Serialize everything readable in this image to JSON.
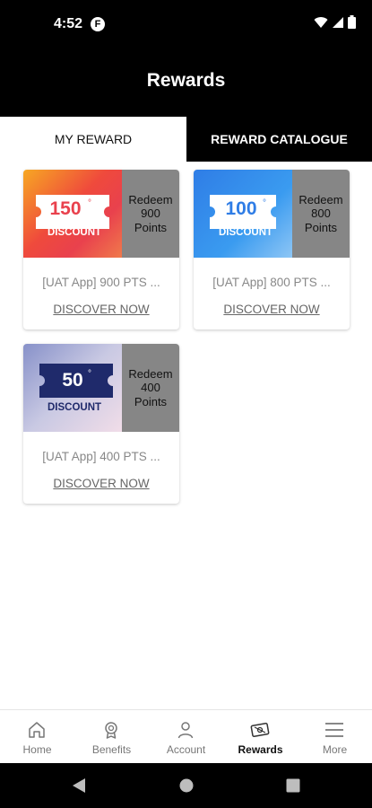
{
  "status_bar": {
    "time": "4:52",
    "app_icon_letter": "F"
  },
  "header": {
    "title": "Rewards"
  },
  "tabs": [
    {
      "label": "MY REWARD",
      "active": true
    },
    {
      "label": "REWARD CATALOGUE",
      "active": false
    }
  ],
  "rewards": [
    {
      "amount": "150",
      "degree": "°",
      "discount_word": "DISCOUNT",
      "redeem": "Redeem 900 Points",
      "title": "[UAT App] 900 PTS ...",
      "link": "DISCOVER NOW",
      "ticket_color": "#ffffff",
      "text_color": "#e9414d"
    },
    {
      "amount": "100",
      "degree": "°",
      "discount_word": "DISCOUNT",
      "redeem": "Redeem 800 Points",
      "title": "[UAT App] 800 PTS ...",
      "link": "DISCOVER NOW",
      "ticket_color": "#ffffff",
      "text_color": "#2f7de6"
    },
    {
      "amount": "50",
      "degree": "°",
      "discount_word": "DISCOUNT",
      "redeem": "Redeem 400 Points",
      "title": "[UAT App] 400 PTS ...",
      "link": "DISCOVER NOW",
      "ticket_color": "#1f2a6b",
      "text_color": "#ffffff"
    }
  ],
  "bottom_nav": [
    {
      "label": "Home",
      "icon": "home-icon",
      "active": false
    },
    {
      "label": "Benefits",
      "icon": "benefits-icon",
      "active": false
    },
    {
      "label": "Account",
      "icon": "account-icon",
      "active": false
    },
    {
      "label": "Rewards",
      "icon": "rewards-icon",
      "active": true
    },
    {
      "label": "More",
      "icon": "menu-icon",
      "active": false
    }
  ],
  "colors": {
    "header_bg": "#000000",
    "redeem_panel": "#868686",
    "active_nav": "#111111",
    "inactive_nav": "#777777"
  }
}
